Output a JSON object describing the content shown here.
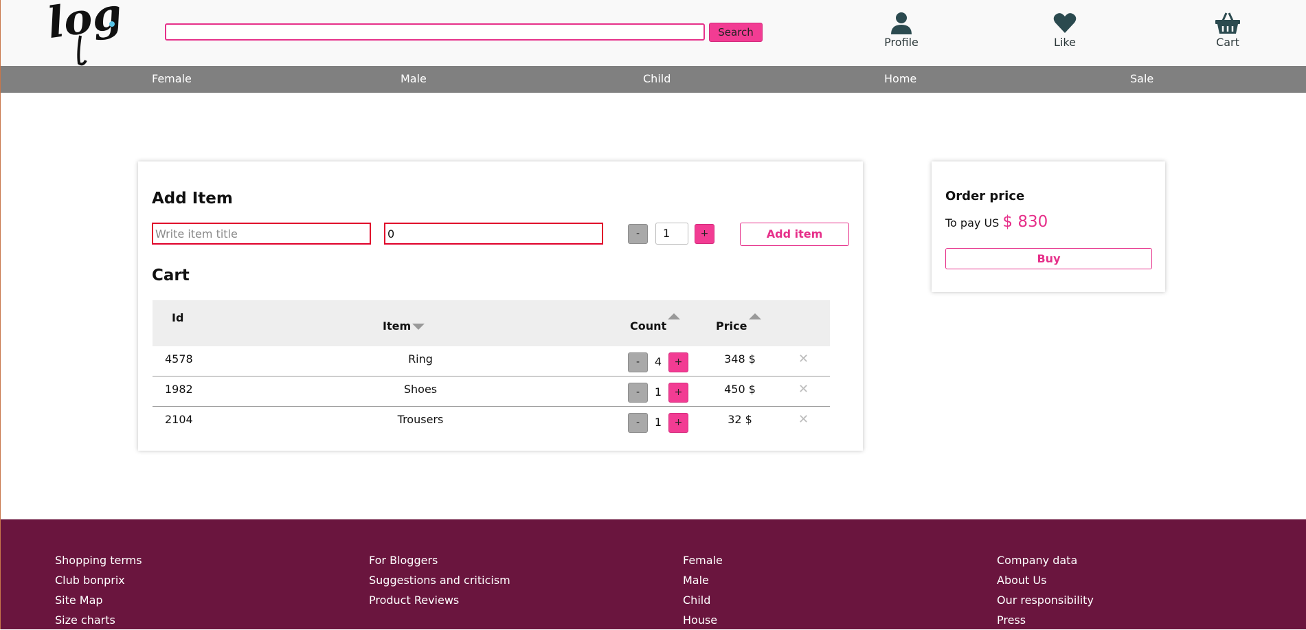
{
  "header": {
    "logo_text": "logo",
    "search_placeholder": "",
    "search_button": "Search",
    "icons": {
      "profile": {
        "label": "Profile",
        "icon": "user-icon"
      },
      "like": {
        "label": "Like",
        "icon": "heart-icon"
      },
      "cart": {
        "label": "Cart",
        "icon": "basket-icon"
      }
    }
  },
  "nav": {
    "items": [
      "Female",
      "Male",
      "Child",
      "Home",
      "Sale"
    ]
  },
  "add_item": {
    "title": "Add Item",
    "title_placeholder": "Write item title",
    "price_value": "0",
    "minus_label": "-",
    "plus_label": "+",
    "quantity": "1",
    "add_button": "Add item"
  },
  "cart": {
    "title": "Cart",
    "columns": {
      "id": "Id",
      "item": "Item",
      "count": "Count",
      "price": "Price"
    },
    "rows": [
      {
        "id": "4578",
        "item": "Ring",
        "count": "4",
        "price": "348 $"
      },
      {
        "id": "1982",
        "item": "Shoes",
        "count": "1",
        "price": "450 $"
      },
      {
        "id": "2104",
        "item": "Trousers",
        "count": "1",
        "price": "32 $"
      }
    ],
    "minus_label": "-",
    "plus_label": "+",
    "remove_label": "✕"
  },
  "order": {
    "title": "Order price",
    "pay_label": "To pay US",
    "amount": "$ 830",
    "buy_button": "Buy"
  },
  "footer": {
    "columns": [
      [
        "Shopping terms",
        "Club bonprix",
        "Site Map",
        "Size charts"
      ],
      [
        "For Bloggers",
        "Suggestions and criticism",
        "Product Reviews"
      ],
      [
        "Female",
        "Male",
        "Child",
        "House"
      ],
      [
        "Company data",
        "About Us",
        "Our responsibility",
        "Press"
      ]
    ]
  },
  "colors": {
    "accent": "#f23c93",
    "nav_bg": "#808080",
    "footer_bg": "#6a153e",
    "icon_color": "#2b4a4f",
    "input_error_border": "#e0002a"
  }
}
